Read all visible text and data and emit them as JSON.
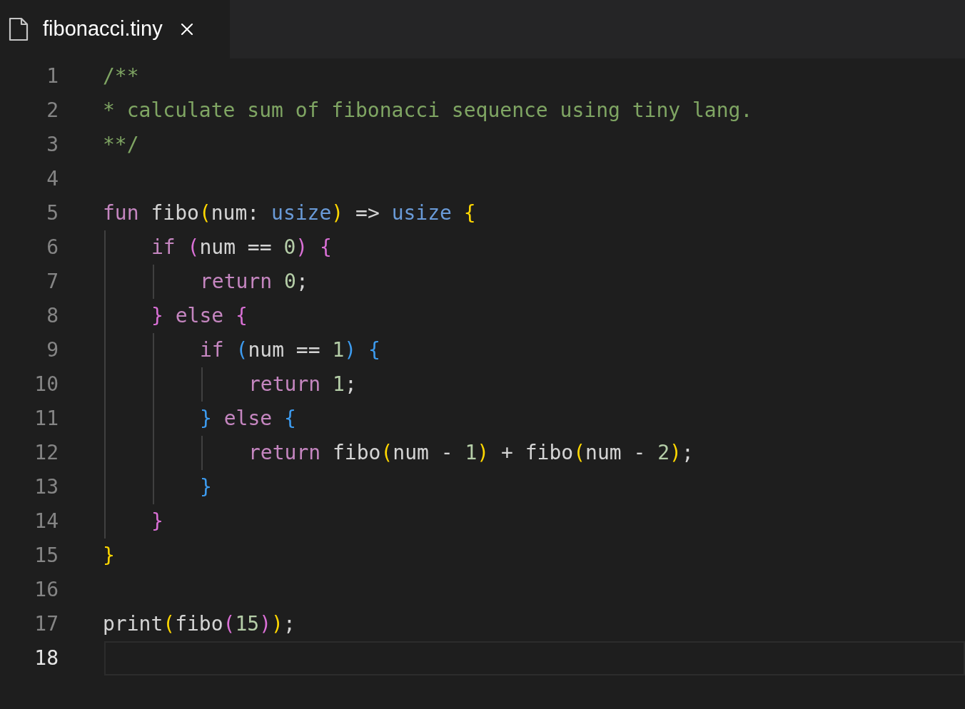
{
  "tab": {
    "title": "fibonacci.tiny",
    "selected": true
  },
  "lines": [
    {
      "number": "1",
      "selected": false,
      "tokens": [
        {
          "text": "/**",
          "kind": "comment"
        }
      ]
    },
    {
      "number": "2",
      "selected": false,
      "tokens": [
        {
          "text": "* calculate sum of fibonacci sequence using tiny lang.",
          "kind": "comment"
        }
      ]
    },
    {
      "number": "3",
      "selected": false,
      "tokens": [
        {
          "text": "**/",
          "kind": "comment"
        }
      ]
    },
    {
      "number": "4",
      "selected": false
    },
    {
      "number": "5",
      "selected": false,
      "tokens": [
        {
          "text": "fun ",
          "kind": "keyword"
        },
        {
          "text": "fibo",
          "kind": "ident"
        },
        {
          "text": "(",
          "kind": "bracket",
          "color": "#ffd700"
        },
        {
          "text": "num: ",
          "kind": "ident"
        },
        {
          "text": "usize",
          "kind": "type"
        },
        {
          "text": ")",
          "kind": "bracket",
          "color": "#ffd700"
        },
        {
          "text": " => ",
          "kind": "ident"
        },
        {
          "text": "usize ",
          "kind": "type"
        },
        {
          "text": "{",
          "kind": "bracket",
          "color": "#ffd700"
        }
      ],
      "children": [
        {
          "number": "6",
          "selected": false,
          "tokens": [
            {
              "text": "if ",
              "kind": "keyword"
            },
            {
              "text": "(",
              "kind": "bracket",
              "color": "#da70d6"
            },
            {
              "text": "num == ",
              "kind": "ident"
            },
            {
              "text": "0",
              "kind": "number"
            },
            {
              "text": ")",
              "kind": "bracket",
              "color": "#da70d6"
            },
            {
              "text": " {",
              "kind": "bracket",
              "color": "#da70d6"
            }
          ],
          "children": [
            {
              "number": "7",
              "selected": false,
              "tokens": [
                {
                  "text": "return ",
                  "kind": "keyword"
                },
                {
                  "text": "0",
                  "kind": "number"
                },
                {
                  "text": ";",
                  "kind": "ident"
                }
              ]
            }
          ]
        },
        {
          "number": "8",
          "selected": false,
          "tokens": [
            {
              "text": "}",
              "kind": "bracket",
              "color": "#da70d6"
            },
            {
              "text": " else ",
              "kind": "keyword"
            },
            {
              "text": "{",
              "kind": "bracket",
              "color": "#da70d6"
            }
          ],
          "children": [
            {
              "number": "9",
              "selected": false,
              "tokens": [
                {
                  "text": "if ",
                  "kind": "keyword"
                },
                {
                  "text": "(",
                  "kind": "bracket",
                  "color": "#3d9cf0"
                },
                {
                  "text": "num == ",
                  "kind": "ident"
                },
                {
                  "text": "1",
                  "kind": "number"
                },
                {
                  "text": ")",
                  "kind": "bracket",
                  "color": "#3d9cf0"
                },
                {
                  "text": " {",
                  "kind": "bracket",
                  "color": "#3d9cf0"
                }
              ],
              "children": [
                {
                  "number": "10",
                  "selected": false,
                  "tokens": [
                    {
                      "text": "return ",
                      "kind": "keyword"
                    },
                    {
                      "text": "1",
                      "kind": "number"
                    },
                    {
                      "text": ";",
                      "kind": "ident"
                    }
                  ]
                }
              ]
            },
            {
              "number": "11",
              "selected": false,
              "tokens": [
                {
                  "text": "}",
                  "kind": "bracket",
                  "color": "#3d9cf0"
                },
                {
                  "text": " else ",
                  "kind": "keyword"
                },
                {
                  "text": "{",
                  "kind": "bracket",
                  "color": "#3d9cf0"
                }
              ],
              "children": [
                {
                  "number": "12",
                  "selected": false,
                  "tokens": [
                    {
                      "text": "return ",
                      "kind": "keyword"
                    },
                    {
                      "text": "fibo",
                      "kind": "ident"
                    },
                    {
                      "text": "(",
                      "kind": "bracket",
                      "color": "#ffd700"
                    },
                    {
                      "text": "num - ",
                      "kind": "ident"
                    },
                    {
                      "text": "1",
                      "kind": "number"
                    },
                    {
                      "text": ")",
                      "kind": "bracket",
                      "color": "#ffd700"
                    },
                    {
                      "text": " + ",
                      "kind": "ident"
                    },
                    {
                      "text": "fibo",
                      "kind": "ident"
                    },
                    {
                      "text": "(",
                      "kind": "bracket",
                      "color": "#ffd700"
                    },
                    {
                      "text": "num - ",
                      "kind": "ident"
                    },
                    {
                      "text": "2",
                      "kind": "number"
                    },
                    {
                      "text": ")",
                      "kind": "bracket",
                      "color": "#ffd700"
                    },
                    {
                      "text": ";",
                      "kind": "ident"
                    }
                  ]
                }
              ]
            },
            {
              "number": "13",
              "selected": false,
              "tokens": [
                {
                  "text": "}",
                  "kind": "bracket",
                  "color": "#3d9cf0"
                }
              ]
            }
          ]
        },
        {
          "number": "14",
          "selected": false,
          "tokens": [
            {
              "text": "}",
              "kind": "bracket",
              "color": "#da70d6"
            }
          ]
        }
      ]
    },
    {
      "number": "15",
      "selected": false,
      "tokens": [
        {
          "text": "}",
          "kind": "bracket",
          "color": "#ffd700"
        }
      ]
    },
    {
      "number": "16",
      "selected": false
    },
    {
      "number": "17",
      "selected": false,
      "tokens": [
        {
          "text": "print",
          "kind": "ident"
        },
        {
          "text": "(",
          "kind": "bracket",
          "color": "#ffd700"
        },
        {
          "text": "fibo",
          "kind": "ident"
        },
        {
          "text": "(",
          "kind": "bracket",
          "color": "#da70d6"
        },
        {
          "text": "15",
          "kind": "number"
        },
        {
          "text": ")",
          "kind": "bracket",
          "color": "#da70d6"
        },
        {
          "text": ")",
          "kind": "bracket",
          "color": "#ffd700"
        },
        {
          "text": ";",
          "kind": "ident"
        }
      ]
    },
    {
      "number": "18",
      "selected": true
    }
  ]
}
